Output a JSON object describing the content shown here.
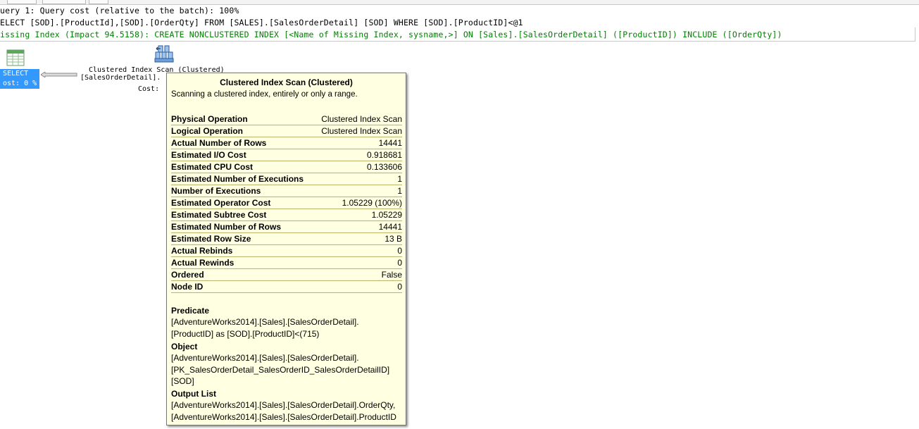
{
  "header": {
    "query_line": "uery 1: Query cost (relative to the batch): 100%",
    "sql_line": "ELECT [SOD].[ProductId],[SOD].[OrderQty] FROM [SALES].[SalesOrderDetail] [SOD] WHERE [SOD].[ProductID]<@1",
    "missing_index_line": "issing Index (Impact 94.5158): CREATE NONCLUSTERED INDEX [<Name of Missing Index, sysname,>] ON [Sales].[SalesOrderDetail] ([ProductID]) INCLUDE ([OrderQty])"
  },
  "plan": {
    "select_node": {
      "label": "SELECT",
      "cost": "ost: 0 %"
    },
    "scan_node": {
      "label": "Clustered Index Scan (Clustered)",
      "object": "[SalesOrderDetail].",
      "cost": "Cost:"
    }
  },
  "tooltip": {
    "title": "Clustered Index Scan (Clustered)",
    "description": "Scanning a clustered index, entirely or only a range.",
    "properties": [
      {
        "key": "Physical Operation",
        "value": "Clustered Index Scan"
      },
      {
        "key": "Logical Operation",
        "value": "Clustered Index Scan"
      },
      {
        "key": "Actual Number of Rows",
        "value": "14441"
      },
      {
        "key": "Estimated I/O Cost",
        "value": "0.918681"
      },
      {
        "key": "Estimated CPU Cost",
        "value": "0.133606"
      },
      {
        "key": "Estimated Number of Executions",
        "value": "1"
      },
      {
        "key": "Number of Executions",
        "value": "1"
      },
      {
        "key": "Estimated Operator Cost",
        "value": "1.05229 (100%)"
      },
      {
        "key": "Estimated Subtree Cost",
        "value": "1.05229"
      },
      {
        "key": "Estimated Number of Rows",
        "value": "14441"
      },
      {
        "key": "Estimated Row Size",
        "value": "13 B"
      },
      {
        "key": "Actual Rebinds",
        "value": "0"
      },
      {
        "key": "Actual Rewinds",
        "value": "0"
      },
      {
        "key": "Ordered",
        "value": "False"
      },
      {
        "key": "Node ID",
        "value": "0"
      }
    ],
    "predicate": {
      "heading": "Predicate",
      "lines": [
        "[AdventureWorks2014].[Sales].[SalesOrderDetail].",
        "[ProductID] as [SOD].[ProductID]<(715)"
      ]
    },
    "object": {
      "heading": "Object",
      "lines": [
        "[AdventureWorks2014].[Sales].[SalesOrderDetail].",
        "[PK_SalesOrderDetail_SalesOrderID_SalesOrderDetailID]",
        "[SOD]"
      ]
    },
    "output_list": {
      "heading": "Output List",
      "lines": [
        "[AdventureWorks2014].[Sales].[SalesOrderDetail].OrderQty,",
        "[AdventureWorks2014].[Sales].[SalesOrderDetail].ProductID"
      ]
    }
  },
  "colors": {
    "missing_index_text": "#008000",
    "selection_blue": "#3399ff",
    "tooltip_background": "#ffffe1",
    "tooltip_row_rule": "#b9b36f"
  },
  "icons": [
    "select-result-icon",
    "clustered-index-scan-icon",
    "data-flow-arrow-icon"
  ]
}
